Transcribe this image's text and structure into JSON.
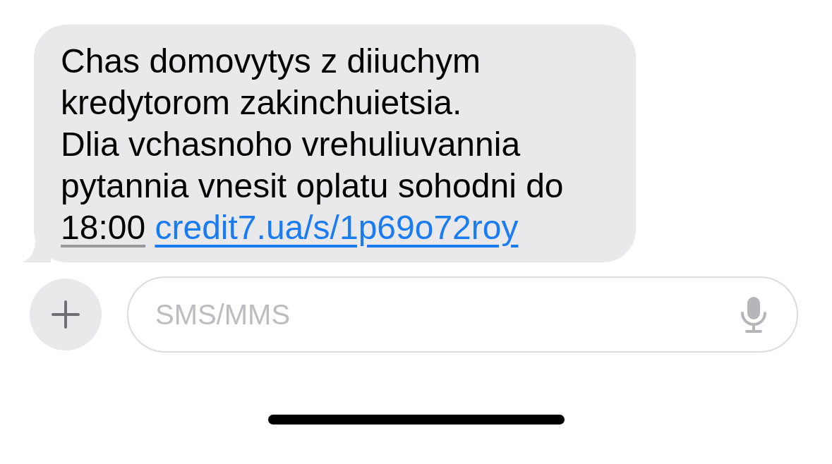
{
  "message": {
    "incoming": true,
    "text": "Chas domovytys z diiuchym kredytorom zakinchuietsia.\nDlia vchasnoho vrehuliuvannia pytannia vnesit oplatu sohodni do",
    "time": "18:00",
    "link": "credit7.ua/s/1p69o72roy"
  },
  "composer": {
    "placeholder": "SMS/MMS"
  }
}
